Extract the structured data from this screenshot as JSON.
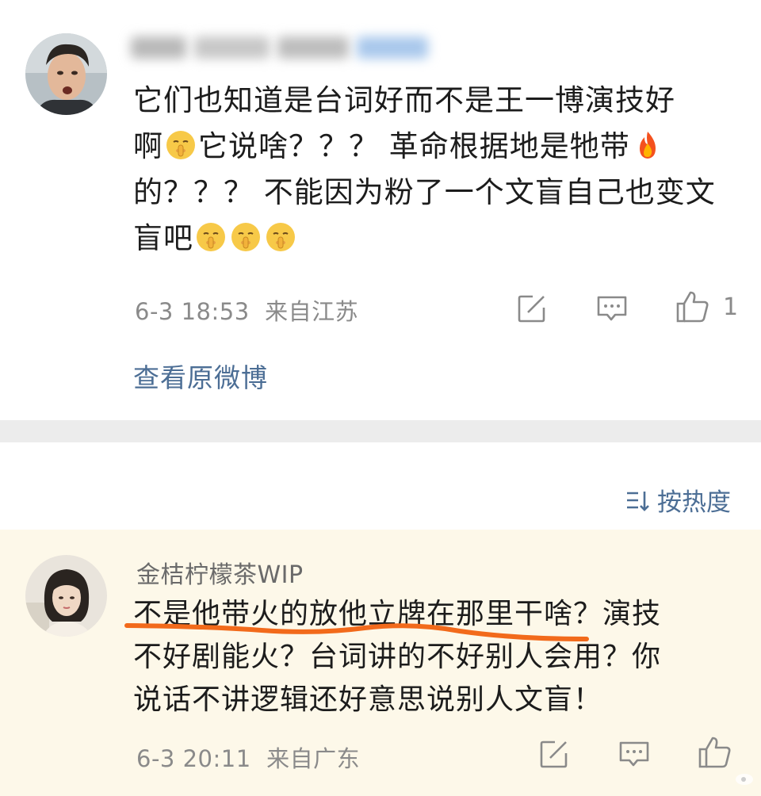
{
  "post": {
    "content_line1": "它们也知道是台词好而不是王一博演技好",
    "content_line2a": "啊",
    "content_line2b": "它说啥？？？ 革命根据地是牠带",
    "content_line3": "的？？？ 不能因为粉了一个文盲自己也变文",
    "content_line4": "盲吧",
    "date": "6-3 18:53",
    "location": "来自江苏",
    "like_count": "1",
    "view_original": "查看原微博"
  },
  "sort": {
    "label": "按热度"
  },
  "comment": {
    "username": "金桔柠檬茶WIP",
    "text_line1": "不是他带火的放他立牌在那里干啥？演技",
    "text_line2": "不好剧能火？台词讲的不好别人会用？你",
    "text_line3": "说话不讲逻辑还好意思说别人文盲！",
    "date": "6-3 20:11",
    "location": "来自广东"
  },
  "colors": {
    "link": "#4c6e95",
    "meta": "#8a8a8a",
    "highlight_bg": "#fdf8e9",
    "underline": "#f26a1b"
  },
  "icons": [
    "edit-icon",
    "comment-icon",
    "like-icon",
    "sort-icon",
    "shush-emoji",
    "fire-emoji"
  ]
}
